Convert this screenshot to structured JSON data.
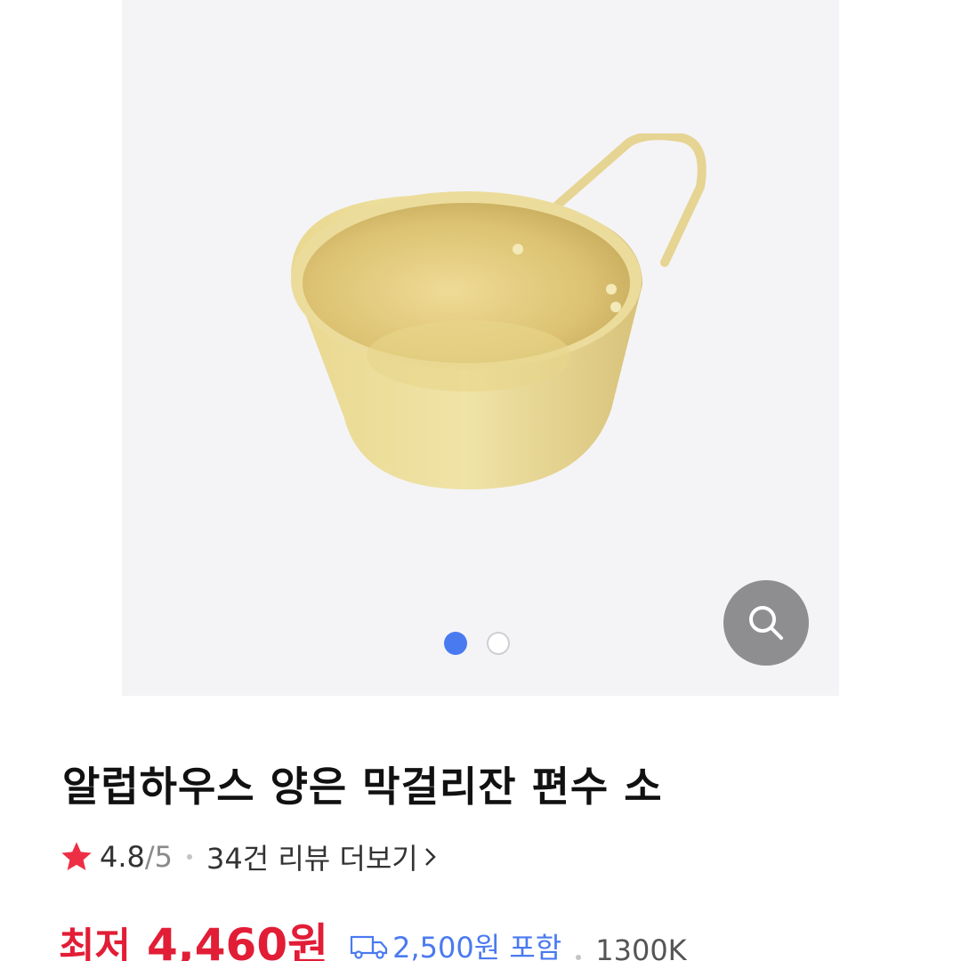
{
  "gallery": {
    "image_alt": "",
    "dots": [
      {
        "state": "active"
      },
      {
        "state": "inactive"
      }
    ],
    "zoom_icon": "search-icon"
  },
  "product": {
    "title": "알럽하우스 양은 막걸리잔 편수 소",
    "rating": {
      "value": "4.8",
      "max": "/5",
      "review_link": "34건 리뷰 더보기",
      "star_icon": "star-icon"
    },
    "price": {
      "label": "최저",
      "value": "4,460원",
      "shipping": "2,500원 포함",
      "shipping_icon": "truck-icon",
      "seller": "1300K"
    }
  },
  "colors": {
    "accent_red": "#e21d36",
    "accent_blue": "#4a7af0",
    "gallery_bg": "#f4f4f6"
  }
}
